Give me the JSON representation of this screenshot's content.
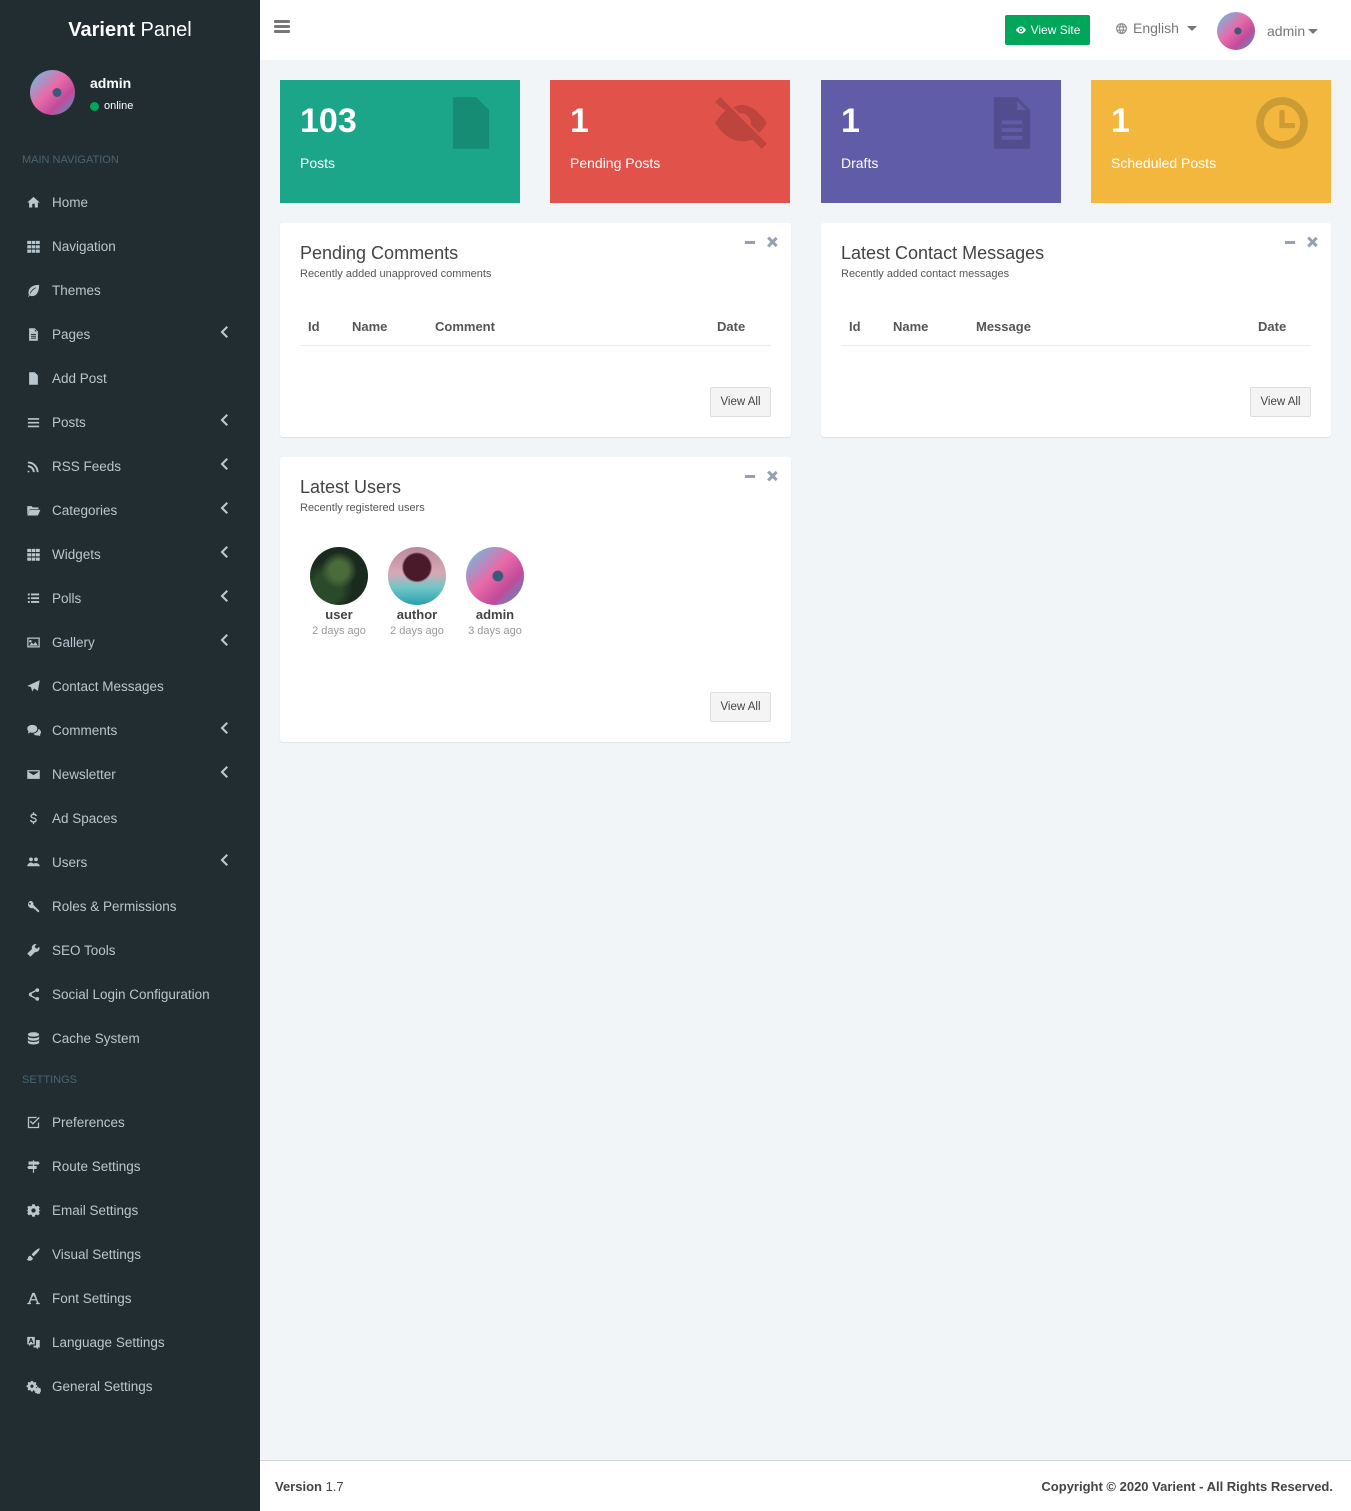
{
  "sidebar": {
    "brand_bold": "Varient",
    "brand_rest": " Panel",
    "user": {
      "name": "admin",
      "status": "online"
    },
    "main_header": "MAIN NAVIGATION",
    "items": [
      {
        "label": "Home",
        "icon": "home-icon",
        "chevron": false
      },
      {
        "label": "Navigation",
        "icon": "grid-icon",
        "chevron": false
      },
      {
        "label": "Themes",
        "icon": "leaf-icon",
        "chevron": false
      },
      {
        "label": "Pages",
        "icon": "file-text-icon",
        "chevron": true
      },
      {
        "label": "Add Post",
        "icon": "file-icon",
        "chevron": false
      },
      {
        "label": "Posts",
        "icon": "bars-icon",
        "chevron": true
      },
      {
        "label": "RSS Feeds",
        "icon": "rss-icon",
        "chevron": true
      },
      {
        "label": "Categories",
        "icon": "folder-open-icon",
        "chevron": true
      },
      {
        "label": "Widgets",
        "icon": "grid-icon",
        "chevron": true
      },
      {
        "label": "Polls",
        "icon": "list-icon",
        "chevron": true
      },
      {
        "label": "Gallery",
        "icon": "image-icon",
        "chevron": true
      },
      {
        "label": "Contact Messages",
        "icon": "paper-plane-icon",
        "chevron": false
      },
      {
        "label": "Comments",
        "icon": "comments-icon",
        "chevron": true
      },
      {
        "label": "Newsletter",
        "icon": "envelope-icon",
        "chevron": true
      },
      {
        "label": "Ad Spaces",
        "icon": "dollar-icon",
        "chevron": false
      },
      {
        "label": "Users",
        "icon": "users-icon",
        "chevron": true
      },
      {
        "label": "Roles & Permissions",
        "icon": "key-icon",
        "chevron": false
      },
      {
        "label": "SEO Tools",
        "icon": "wrench-icon",
        "chevron": false
      },
      {
        "label": "Social Login Configuration",
        "icon": "share-icon",
        "chevron": false
      },
      {
        "label": "Cache System",
        "icon": "database-icon",
        "chevron": false
      }
    ],
    "settings_header": "SETTINGS",
    "settings_items": [
      {
        "label": "Preferences",
        "icon": "check-square-icon"
      },
      {
        "label": "Route Settings",
        "icon": "signs-icon"
      },
      {
        "label": "Email Settings",
        "icon": "cog-icon"
      },
      {
        "label": "Visual Settings",
        "icon": "paint-brush-icon"
      },
      {
        "label": "Font Settings",
        "icon": "font-icon"
      },
      {
        "label": "Language Settings",
        "icon": "language-icon"
      },
      {
        "label": "General Settings",
        "icon": "cogs-icon"
      }
    ]
  },
  "topbar": {
    "view_site": "View Site",
    "language": "English",
    "user": "admin"
  },
  "stats": [
    {
      "value": "103",
      "label": "Posts",
      "color": "#1ba68a",
      "icon": "file-icon"
    },
    {
      "value": "1",
      "label": "Pending Posts",
      "color": "#e0524a",
      "icon": "eye-slash-icon"
    },
    {
      "value": "1",
      "label": "Drafts",
      "color": "#605ca8",
      "icon": "file-text-icon"
    },
    {
      "value": "1",
      "label": "Scheduled Posts",
      "color": "#f3b73d",
      "icon": "clock-icon"
    }
  ],
  "pending_comments": {
    "title": "Pending Comments",
    "subtitle": "Recently added unapproved comments",
    "columns": [
      "Id",
      "Name",
      "Comment",
      "Date"
    ],
    "view_all": "View All"
  },
  "contact_messages": {
    "title": "Latest Contact Messages",
    "subtitle": "Recently added contact messages",
    "columns": [
      "Id",
      "Name",
      "Message",
      "Date"
    ],
    "view_all": "View All"
  },
  "latest_users": {
    "title": "Latest Users",
    "subtitle": "Recently registered users",
    "users": [
      {
        "name": "user",
        "time": "2 days ago"
      },
      {
        "name": "author",
        "time": "2 days ago"
      },
      {
        "name": "admin",
        "time": "3 days ago"
      }
    ],
    "view_all": "View All"
  },
  "footer": {
    "version_label": "Version",
    "version": " 1.7",
    "copyright": "Copyright © 2020 Varient - All Rights Reserved."
  }
}
